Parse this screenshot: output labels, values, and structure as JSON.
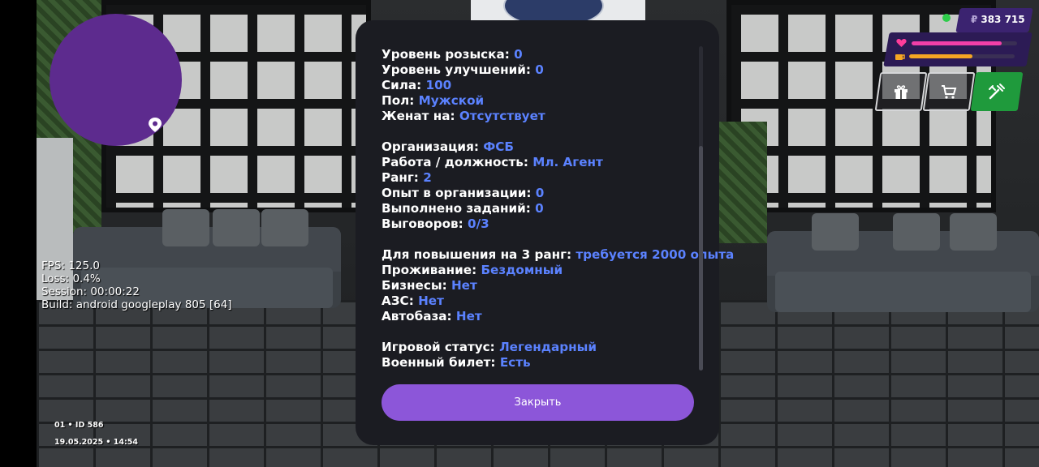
{
  "hud": {
    "money": "383 715",
    "currency_symbol": "₽",
    "health_fraction": 0.85,
    "hunger_fraction": 0.6,
    "buttons": [
      "gift-icon",
      "cart-icon",
      "wrench-icon"
    ],
    "accent": "#8c56d9",
    "value_color": "#5b82ff"
  },
  "debug": {
    "fps": "FPS: 125.0",
    "loss": "Loss: 0.4%",
    "session": "Session: 00:00:22",
    "build": "Build: android googleplay 805 [64]"
  },
  "corner": {
    "id_line": "01 • ID 586",
    "date_line": "19.05.2025 • 14:54"
  },
  "panel": {
    "rows": [
      {
        "label": "Уровень розыска:",
        "value": "0"
      },
      {
        "label": "Уровень улучшений:",
        "value": "0"
      },
      {
        "label": "Сила:",
        "value": "100"
      },
      {
        "label": "Пол:",
        "value": "Мужской"
      },
      {
        "label": "Женат на:",
        "value": "Отсутствует"
      },
      {
        "label": "Организация:",
        "value": "ФСБ"
      },
      {
        "label": "Работа / должность:",
        "value": "Мл. Агент"
      },
      {
        "label": "Ранг:",
        "value": "2"
      },
      {
        "label": "Опыт в организации:",
        "value": "0"
      },
      {
        "label": "Выполнено заданий:",
        "value": "0"
      },
      {
        "label": "Выговоров:",
        "value": "0/3"
      },
      {
        "label": "Для повышения на 3 ранг:",
        "value": "требуется 2000 опыта"
      },
      {
        "label": "Проживание:",
        "value": "Бездомный"
      },
      {
        "label": "Бизнесы:",
        "value": "Нет"
      },
      {
        "label": "АЗС:",
        "value": "Нет"
      },
      {
        "label": "Автобаза:",
        "value": "Нет"
      },
      {
        "label": "Игровой статус:",
        "value": "Легендарный"
      },
      {
        "label": "Военный билет:",
        "value": "Есть"
      }
    ],
    "close_label": "Закрыть"
  }
}
